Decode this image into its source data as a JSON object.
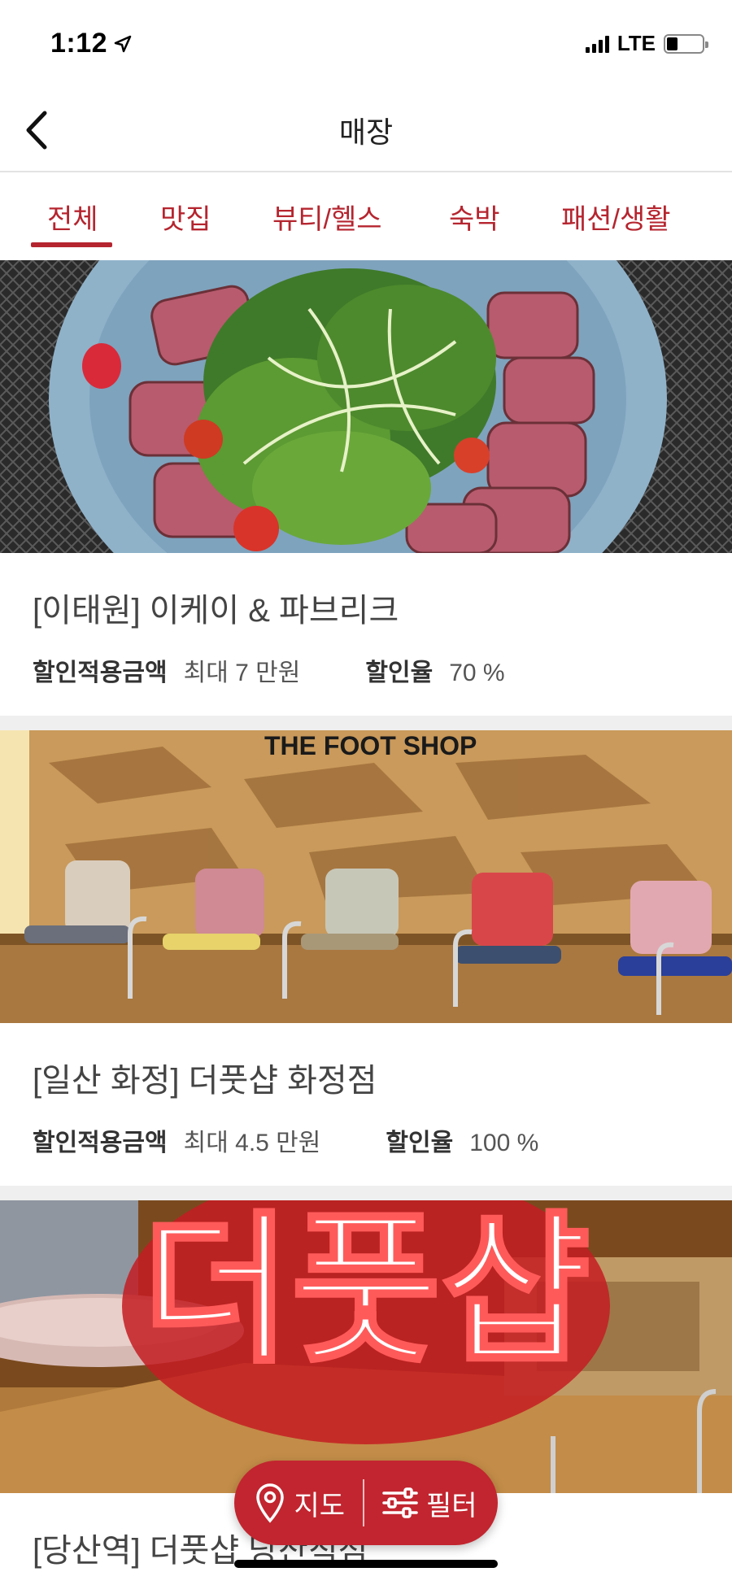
{
  "status_bar": {
    "time": "1:12",
    "network": "LTE"
  },
  "nav": {
    "title": "매장"
  },
  "tabs": [
    {
      "label": "전체"
    },
    {
      "label": "맛집"
    },
    {
      "label": "뷰티/헬스"
    },
    {
      "label": "숙박"
    },
    {
      "label": "패션/생활"
    }
  ],
  "stores": [
    {
      "name": "[이태원] 이케이 & 파브리크",
      "discount_amount_label": "할인적용금액",
      "discount_amount_value": "최대 7 만원",
      "discount_rate_label": "할인율",
      "discount_rate_value": "70 %"
    },
    {
      "name": "[일산 화정] 더풋샵 화정점",
      "discount_amount_label": "할인적용금액",
      "discount_amount_value": "최대 4.5 만원",
      "discount_rate_label": "할인율",
      "discount_rate_value": "100 %",
      "image_sign": "THE FOOT SHOP"
    },
    {
      "name": "[당산역] 더풋샵 당산직점",
      "image_sign": "더풋샵"
    }
  ],
  "fab": {
    "map_label": "지도",
    "filter_label": "필터"
  },
  "colors": {
    "accent": "#b5252f",
    "fab": "#c2252f"
  }
}
